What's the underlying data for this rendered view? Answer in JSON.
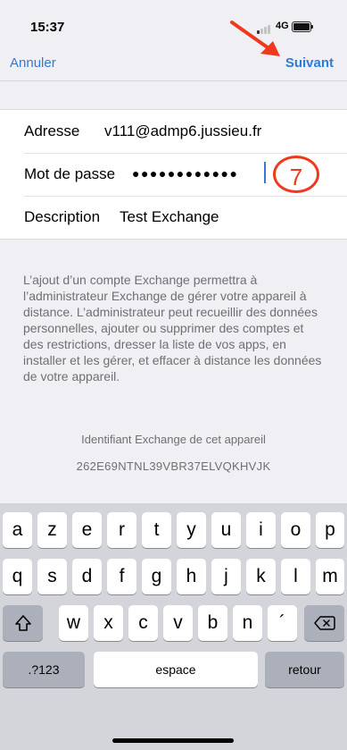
{
  "status": {
    "time": "15:37",
    "network": "4G"
  },
  "nav": {
    "cancel": "Annuler",
    "next": "Suivant"
  },
  "form": {
    "address_label": "Adresse",
    "address_value": "v111@admp6.jussieu.fr",
    "password_label": "Mot de passe",
    "password_value": "●●●●●●●●●●●●",
    "description_label": "Description",
    "description_value": "Test Exchange"
  },
  "annotation": {
    "step": "7",
    "color": "#f0381c"
  },
  "info_text": "L’ajout d’un compte Exchange permettra à l’administrateur Exchange de gérer votre appareil à distance. L’administrateur peut recueillir des données personnelles, ajouter ou supprimer des comptes et des restrictions, dresser la liste de vos apps, en installer et les gérer, et effacer à distance les données de votre appareil.",
  "device": {
    "title": "Identifiant Exchange de cet appareil",
    "id": "262E69NTNL39VBR37ELVQKHVJK"
  },
  "keyboard": {
    "row1": [
      "a",
      "z",
      "e",
      "r",
      "t",
      "y",
      "u",
      "i",
      "o",
      "p"
    ],
    "row2": [
      "q",
      "s",
      "d",
      "f",
      "g",
      "h",
      "j",
      "k",
      "l",
      "m"
    ],
    "row3": [
      "w",
      "x",
      "c",
      "v",
      "b",
      "n",
      "´"
    ],
    "numbers": ".?123",
    "space": "espace",
    "return": "retour"
  },
  "colors": {
    "accent": "#2f7bd6",
    "background": "#efeff4",
    "keyboard": "#d3d5db"
  }
}
